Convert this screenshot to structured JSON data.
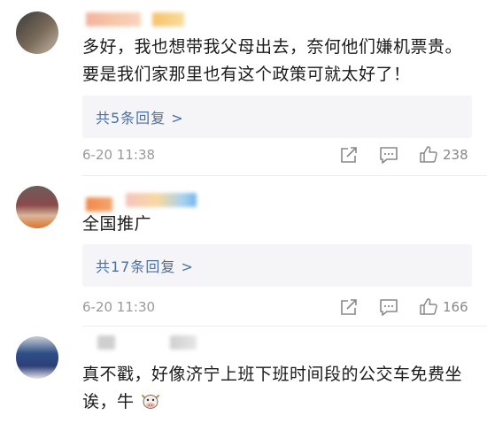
{
  "comments": [
    {
      "text": "多好，我也想带我父母出去，奈何他们嫌机票贵。要是我们家那里也有这个政策可就太好了！",
      "replies_label": "共5条回复 >",
      "time": "6-20 11:38",
      "likes": "238"
    },
    {
      "text": "全国推广",
      "replies_label": "共17条回复 >",
      "time": "6-20 11:30",
      "likes": "166"
    },
    {
      "text": "真不戳，好像济宁上班下班时间段的公交车免费坐诶，牛"
    }
  ],
  "icons": {
    "share": "share-icon",
    "comment": "comment-icon",
    "like": "thumbs-up-icon",
    "emoji": "cow-emoji-icon"
  },
  "colors": {
    "link": "#4a6fa5",
    "reply_bg": "#f5f5f7",
    "meta": "#999999"
  }
}
